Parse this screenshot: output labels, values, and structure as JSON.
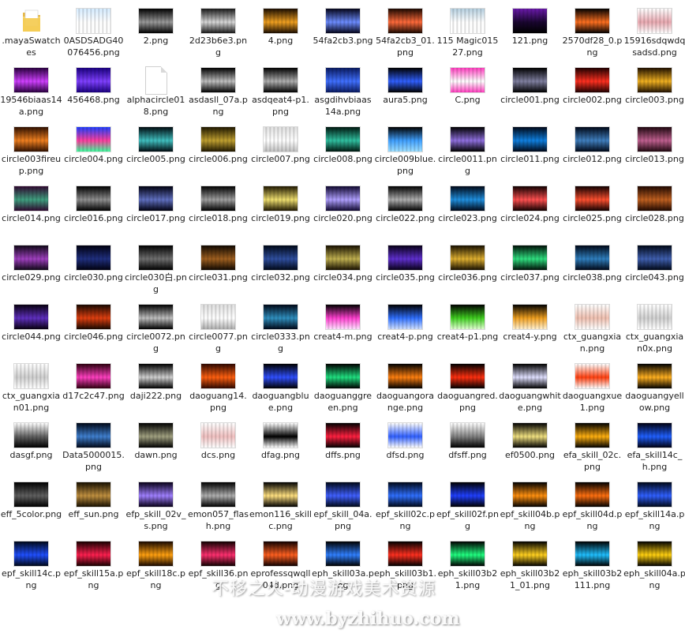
{
  "files": [
    {
      "name": ".mayaSwatches",
      "kind": "folder"
    },
    {
      "name": "0ASDSADG40076456.png",
      "c1": "#d6ecff",
      "c2": "#ffffff",
      "c3": "#ffffff"
    },
    {
      "name": "2.png",
      "c1": "#000000",
      "c2": "#9a9a9a",
      "c3": "#000000"
    },
    {
      "name": "2d23b6e3.png",
      "c1": "#1a1a1a",
      "c2": "#d8d8d8",
      "c3": "#1a1a1a"
    },
    {
      "name": "4.png",
      "c1": "#1a0c00",
      "c2": "#f0a020",
      "c3": "#1a0c00"
    },
    {
      "name": "54fa2cb3.png",
      "c1": "#05051a",
      "c2": "#6c8cff",
      "c3": "#05051a"
    },
    {
      "name": "54fa2cb3_01.png",
      "c1": "#1a0800",
      "c2": "#ff6a3a",
      "c3": "#1a0800"
    },
    {
      "name": "115 Magic01527.png",
      "c1": "#b6d0e0",
      "c2": "#ffffff",
      "c3": "#ffffff"
    },
    {
      "name": "121.png",
      "c1": "#6a1aaa",
      "c2": "#1a0630",
      "c3": "#000000"
    },
    {
      "name": "2570df28_0.png",
      "c1": "#000000",
      "c2": "#ff7020",
      "c3": "#000000"
    },
    {
      "name": "15916sdqwdqsadsd.png",
      "c1": "#ffffff",
      "c2": "#e8a8b0",
      "c3": "#ffffff"
    },
    {
      "name": "19546biaas14a.png",
      "c1": "#2a0040",
      "c2": "#d040ff",
      "c3": "#2a0040"
    },
    {
      "name": "456468.png",
      "c1": "#1a0080",
      "c2": "#8040ff",
      "c3": "#1a0080"
    },
    {
      "name": "alphacircle018.png",
      "kind": "blank"
    },
    {
      "name": "asdasll_07a.png",
      "c1": "#000000",
      "c2": "#c0c0c0",
      "c3": "#000000"
    },
    {
      "name": "asdqeat4-p1.png",
      "c1": "#000000",
      "c2": "#b0b0b0",
      "c3": "#000000"
    },
    {
      "name": "asgdihvbiaas14a.png",
      "c1": "#0a1a60",
      "c2": "#4070ff",
      "c3": "#0a1a60"
    },
    {
      "name": "aura5.png",
      "c1": "#000000",
      "c2": "#3060ff",
      "c3": "#000000"
    },
    {
      "name": "C.png",
      "c1": "#ff40c0",
      "c2": "#ffffff",
      "c3": "#ff40c0"
    },
    {
      "name": "circle001.png",
      "c1": "#000000",
      "c2": "#8080a0",
      "c3": "#000000"
    },
    {
      "name": "circle002.png",
      "c1": "#200000",
      "c2": "#ff3020",
      "c3": "#200000"
    },
    {
      "name": "circle003.png",
      "c1": "#201000",
      "c2": "#f0b020",
      "c3": "#201000"
    },
    {
      "name": "circle003fireup.png",
      "c1": "#301000",
      "c2": "#f08020",
      "c3": "#301000"
    },
    {
      "name": "circle004.png",
      "c1": "#2040ff",
      "c2": "#ff40a0",
      "c3": "#40ffa0"
    },
    {
      "name": "circle005.png",
      "c1": "#000a10",
      "c2": "#40c0c0",
      "c3": "#000a10"
    },
    {
      "name": "circle006.png",
      "c1": "#201800",
      "c2": "#c0a030",
      "c3": "#201800"
    },
    {
      "name": "circle007.png",
      "c1": "#e0e0e0",
      "c2": "#ffffff",
      "c3": "#c0c0c0"
    },
    {
      "name": "circle008.png",
      "c1": "#001810",
      "c2": "#30c0a0",
      "c3": "#001810"
    },
    {
      "name": "circle009blue.png",
      "c1": "#000000",
      "c2": "#40a0ff",
      "c3": "#a0e0ff"
    },
    {
      "name": "circle0011.png",
      "c1": "#000000",
      "c2": "#9070e0",
      "c3": "#000000"
    },
    {
      "name": "circle011.png",
      "c1": "#000818",
      "c2": "#1080e0",
      "c3": "#000818"
    },
    {
      "name": "circle012.png",
      "c1": "#000818",
      "c2": "#4080c0",
      "c3": "#000818"
    },
    {
      "name": "circle013.png",
      "c1": "#200810",
      "c2": "#c06090",
      "c3": "#200810"
    },
    {
      "name": "circle014.png",
      "c1": "#300830",
      "c2": "#40a080",
      "c3": "#300830"
    },
    {
      "name": "circle016.png",
      "c1": "#000000",
      "c2": "#909090",
      "c3": "#000000"
    },
    {
      "name": "circle017.png",
      "c1": "#000010",
      "c2": "#6070c0",
      "c3": "#000010"
    },
    {
      "name": "circle018.png",
      "c1": "#000000",
      "c2": "#a0a0a0",
      "c3": "#000000"
    },
    {
      "name": "circle019.png",
      "c1": "#201800",
      "c2": "#f0e070",
      "c3": "#201800"
    },
    {
      "name": "circle020.png",
      "c1": "#100830",
      "c2": "#b0a0ff",
      "c3": "#100830"
    },
    {
      "name": "circle022.png",
      "c1": "#000000",
      "c2": "#b0b0b0",
      "c3": "#000000"
    },
    {
      "name": "circle023.png",
      "c1": "#000818",
      "c2": "#2090e0",
      "c3": "#000818"
    },
    {
      "name": "circle024.png",
      "c1": "#100000",
      "c2": "#ff5050",
      "c3": "#100000"
    },
    {
      "name": "circle025.png",
      "c1": "#100000",
      "c2": "#ff5030",
      "c3": "#100000"
    },
    {
      "name": "circle028.png",
      "c1": "#200800",
      "c2": "#c06020",
      "c3": "#200800"
    },
    {
      "name": "circle029.png",
      "c1": "#100818",
      "c2": "#a040c0",
      "c3": "#100818"
    },
    {
      "name": "circle030.png",
      "c1": "#000010",
      "c2": "#203080",
      "c3": "#000010"
    },
    {
      "name": "circle030白.png",
      "c1": "#000000",
      "c2": "#707070",
      "c3": "#000000"
    },
    {
      "name": "circle031.png",
      "c1": "#100800",
      "c2": "#a06020",
      "c3": "#100800"
    },
    {
      "name": "circle032.png",
      "c1": "#000818",
      "c2": "#3050a0",
      "c3": "#000818"
    },
    {
      "name": "circle034.png",
      "c1": "#181000",
      "c2": "#c0b050",
      "c3": "#181000"
    },
    {
      "name": "circle035.png",
      "c1": "#080018",
      "c2": "#6030d0",
      "c3": "#080018"
    },
    {
      "name": "circle036.png",
      "c1": "#181000",
      "c2": "#e0b030",
      "c3": "#181000"
    },
    {
      "name": "circle037.png",
      "c1": "#001008",
      "c2": "#30e080",
      "c3": "#001008"
    },
    {
      "name": "circle038.png",
      "c1": "#000818",
      "c2": "#3080c0",
      "c3": "#000818"
    },
    {
      "name": "circle043.png",
      "c1": "#000818",
      "c2": "#4060b0",
      "c3": "#000818"
    },
    {
      "name": "circle044.png",
      "c1": "#080010",
      "c2": "#6030c0",
      "c3": "#080010"
    },
    {
      "name": "circle046.png",
      "c1": "#180800",
      "c2": "#e04010",
      "c3": "#180800"
    },
    {
      "name": "circle0072.png",
      "c1": "#000000",
      "c2": "#c0c0c0",
      "c3": "#000000"
    },
    {
      "name": "circle0077.png",
      "c1": "#e0e0e0",
      "c2": "#ffffff",
      "c3": "#b0b0b0"
    },
    {
      "name": "circle0333.png",
      "c1": "#000818",
      "c2": "#3090c0",
      "c3": "#000818"
    },
    {
      "name": "creat4-m.png",
      "c1": "#000000",
      "c2": "#ff40d0",
      "c3": "#ffe0ff"
    },
    {
      "name": "creat4-p.png",
      "c1": "#000000",
      "c2": "#3070ff",
      "c3": "#d0e0ff"
    },
    {
      "name": "creat4-p1.png",
      "c1": "#000000",
      "c2": "#40d020",
      "c3": "#e0ffd0"
    },
    {
      "name": "creat4-y.png",
      "c1": "#000000",
      "c2": "#f0a020",
      "c3": "#fff0d0"
    },
    {
      "name": "ctx_guangxian.png",
      "c1": "#ffffff",
      "c2": "#f0c0b0",
      "c3": "#ffffff"
    },
    {
      "name": "ctx_guangxian0x.png",
      "c1": "#ffffff",
      "c2": "#d0d0d0",
      "c3": "#ffffff"
    },
    {
      "name": "ctx_guangxian01.png",
      "c1": "#ffffff",
      "c2": "#d0d0d0",
      "c3": "#ffffff"
    },
    {
      "name": "d17c2c47.png",
      "c1": "#300010",
      "c2": "#ff40c0",
      "c3": "#300010"
    },
    {
      "name": "daji222.png",
      "c1": "#000000",
      "c2": "#d0d0d0",
      "c3": "#000000"
    },
    {
      "name": "daoguang14.png",
      "c1": "#300800",
      "c2": "#ff6010",
      "c3": "#300800"
    },
    {
      "name": "daoguangblue.png",
      "c1": "#000000",
      "c2": "#3050ff",
      "c3": "#000000"
    },
    {
      "name": "daoguanggreen.png",
      "c1": "#000000",
      "c2": "#20e080",
      "c3": "#000000"
    },
    {
      "name": "daoguangorange.png",
      "c1": "#000000",
      "c2": "#ff8010",
      "c3": "#000000"
    },
    {
      "name": "daoguangred.png",
      "c1": "#000000",
      "c2": "#ff3010",
      "c3": "#000000"
    },
    {
      "name": "daoguangwhite.png",
      "c1": "#000000",
      "c2": "#e0e0ff",
      "c3": "#000000"
    },
    {
      "name": "daoguangxue1.png",
      "c1": "#ffffff",
      "c2": "#ff4010",
      "c3": "#ffffff"
    },
    {
      "name": "daoguangyellow.png",
      "c1": "#000000",
      "c2": "#ffb020",
      "c3": "#000000"
    },
    {
      "name": "dasgf.png",
      "c1": "#ffffff",
      "c2": "#606060",
      "c3": "#000000"
    },
    {
      "name": "Data5000015.png",
      "c1": "#000818",
      "c2": "#4080d0",
      "c3": "#000818"
    },
    {
      "name": "dawn.png",
      "c1": "#000000",
      "c2": "#a0a080",
      "c3": "#000000"
    },
    {
      "name": "dcs.png",
      "c1": "#ffffff",
      "c2": "#f0c0c0",
      "c3": "#ffffff"
    },
    {
      "name": "dfag.png",
      "c1": "#ffffff",
      "c2": "#000000",
      "c3": "#ffffff"
    },
    {
      "name": "dffs.png",
      "c1": "#000000",
      "c2": "#ff2040",
      "c3": "#000000"
    },
    {
      "name": "dfsd.png",
      "c1": "#ffffff",
      "c2": "#3060ff",
      "c3": "#ffffff"
    },
    {
      "name": "dfsff.png",
      "c1": "#ffffff",
      "c2": "#808080",
      "c3": "#000000"
    },
    {
      "name": "ef0500.png",
      "c1": "#000000",
      "c2": "#f0e080",
      "c3": "#000000"
    },
    {
      "name": "efa_skill_02c.png",
      "c1": "#000000",
      "c2": "#ffb010",
      "c3": "#000000"
    },
    {
      "name": "efa_skill14c_h.png",
      "c1": "#000010",
      "c2": "#2060ff",
      "c3": "#000010"
    },
    {
      "name": "eff_5color.png",
      "c1": "#000000",
      "c2": "#606060",
      "c3": "#000000"
    },
    {
      "name": "eff_sun.png",
      "c1": "#181000",
      "c2": "#c09040",
      "c3": "#181000"
    },
    {
      "name": "efp_skill_02v_s.png",
      "c1": "#080018",
      "c2": "#a080ff",
      "c3": "#080018"
    },
    {
      "name": "emon057_flash.png",
      "c1": "#000000",
      "c2": "#b0b0b0",
      "c3": "#000000"
    },
    {
      "name": "emon116_skillc.png",
      "c1": "#000000",
      "c2": "#ffe080",
      "c3": "#000000"
    },
    {
      "name": "epf_skill_04a.png",
      "c1": "#000818",
      "c2": "#4060ff",
      "c3": "#000818"
    },
    {
      "name": "epf_skill02c.png",
      "c1": "#000818",
      "c2": "#3070ff",
      "c3": "#000818"
    },
    {
      "name": "epf_skill02f.png",
      "c1": "#000000",
      "c2": "#2040ff",
      "c3": "#000000"
    },
    {
      "name": "epf_skill04b.png",
      "c1": "#000000",
      "c2": "#ff9010",
      "c3": "#000000"
    },
    {
      "name": "epf_skill04d.png",
      "c1": "#000000",
      "c2": "#ff7010",
      "c3": "#000000"
    },
    {
      "name": "epf_skill14a.png",
      "c1": "#000818",
      "c2": "#3060ff",
      "c3": "#000818"
    },
    {
      "name": "epf_skill14c.png",
      "c1": "#000818",
      "c2": "#2050ff",
      "c3": "#000818"
    },
    {
      "name": "epf_skill15a.png",
      "c1": "#180000",
      "c2": "#ff2050",
      "c3": "#180000"
    },
    {
      "name": "epf_skill18c.png",
      "c1": "#180800",
      "c2": "#ffa010",
      "c3": "#180800"
    },
    {
      "name": "epf_skill36.png",
      "c1": "#100000",
      "c2": "#ff3070",
      "c3": "#100000"
    },
    {
      "name": "eprofessqwqll04d.png",
      "c1": "#100000",
      "c2": "#ff6020",
      "c3": "#100000"
    },
    {
      "name": "eph_skill03a.png",
      "c1": "#000000",
      "c2": "#3080ff",
      "c3": "#000000"
    },
    {
      "name": "eph_skill03b1.png",
      "c1": "#000000",
      "c2": "#ff3020",
      "c3": "#000000"
    },
    {
      "name": "eph_skill03b21.png",
      "c1": "#000000",
      "c2": "#20ff80",
      "c3": "#000000"
    },
    {
      "name": "eph_skill03b21_01.png",
      "c1": "#000000",
      "c2": "#ffd020",
      "c3": "#000000"
    },
    {
      "name": "eph_skill03b2111.png",
      "c1": "#000000",
      "c2": "#20c0ff",
      "c3": "#000000"
    },
    {
      "name": "eph_skill04a.png",
      "c1": "#000000",
      "c2": "#ffd010",
      "c3": "#000000"
    }
  ],
  "watermark": {
    "line1": "不移之火-动漫游戏美术资源",
    "line2": "www.byzhihuo.com"
  }
}
